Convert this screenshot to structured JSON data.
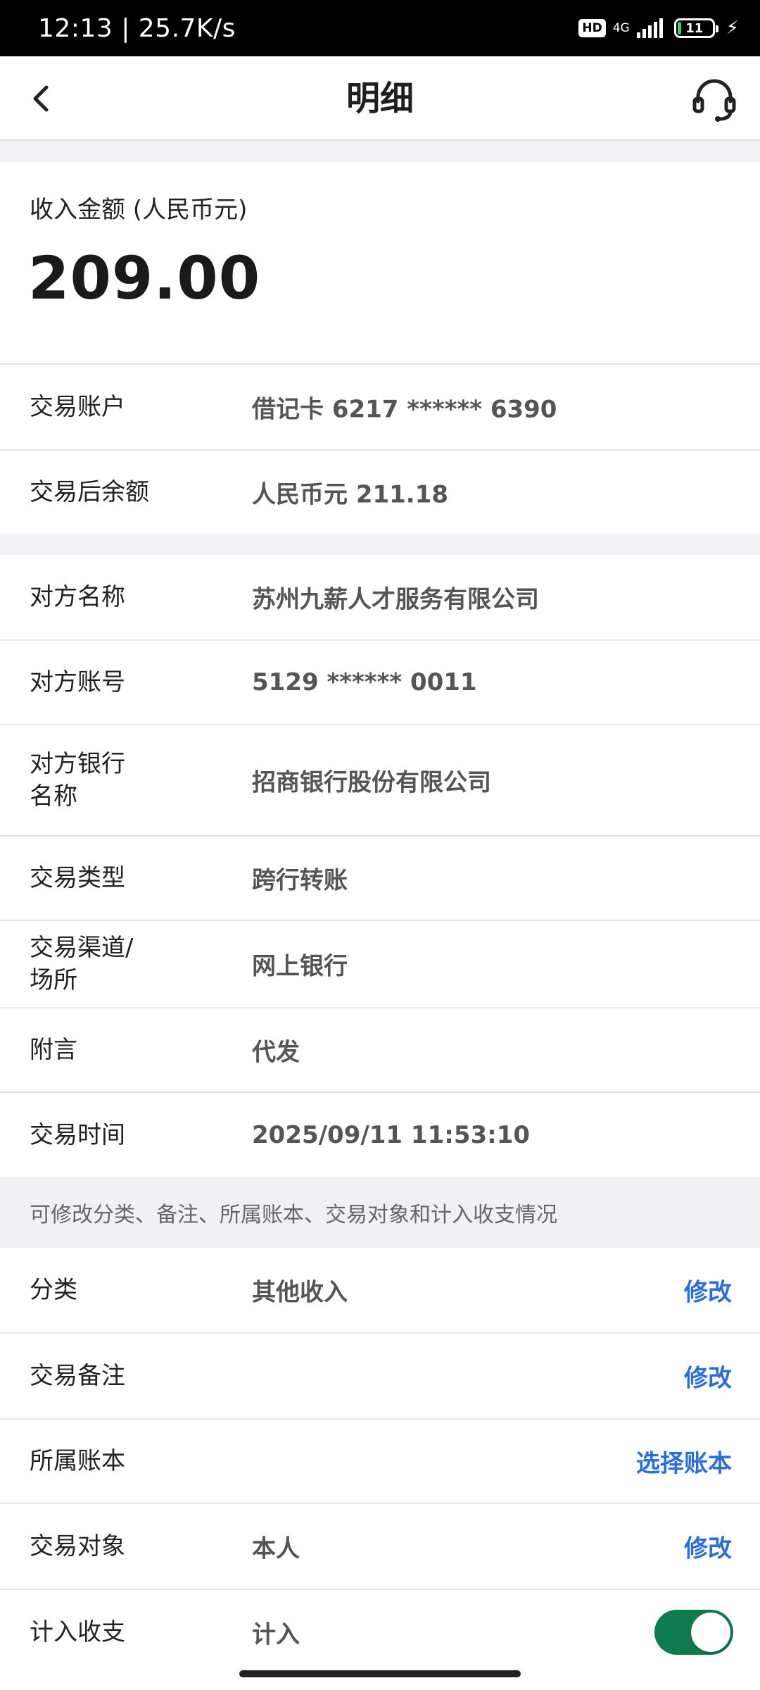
{
  "status_bar": {
    "time_speed": "12:13 | 25.7K/s",
    "hd": "HD",
    "network": "4G",
    "battery": "11",
    "battery_level": 0.11,
    "colors": {
      "battery_fill": "#3bd16f"
    }
  },
  "header": {
    "title": "明细",
    "icons": {
      "back": "chevron-left-icon",
      "service": "headset-icon"
    }
  },
  "amount": {
    "label": "收入金额 (人民币元)",
    "value": "209.00"
  },
  "account_section": [
    {
      "label": "交易账户",
      "value": "借记卡 6217 ****** 6390"
    },
    {
      "label": "交易后余额",
      "value": "人民币元 211.18"
    }
  ],
  "detail_section": [
    {
      "label": "对方名称",
      "value": "苏州九薪人才服务有限公司"
    },
    {
      "label": "对方账号",
      "value": "5129 ****** 0011"
    },
    {
      "label": "对方银行\n名称",
      "value": "招商银行股份有限公司"
    },
    {
      "label": "交易类型",
      "value": "跨行转账"
    },
    {
      "label": "交易渠道/\n场所",
      "value": "网上银行"
    },
    {
      "label": "附言",
      "value": "代发"
    },
    {
      "label": "交易时间",
      "value": "2025/09/11 11:53:10"
    }
  ],
  "edit_note": "可修改分类、备注、所属账本、交易对象和计入收支情况",
  "edit_section": [
    {
      "label": "分类",
      "value": "其他收入",
      "action": "修改"
    },
    {
      "label": "交易备注",
      "value": "",
      "action": "修改"
    },
    {
      "label": "所属账本",
      "value": "",
      "action": "选择账本"
    },
    {
      "label": "交易对象",
      "value": "本人",
      "action": "修改"
    },
    {
      "label": "计入收支",
      "value": "计入",
      "toggle_on": true
    }
  ],
  "colors": {
    "action": "#2b6fd6",
    "toggle": "#0e7a4f"
  }
}
